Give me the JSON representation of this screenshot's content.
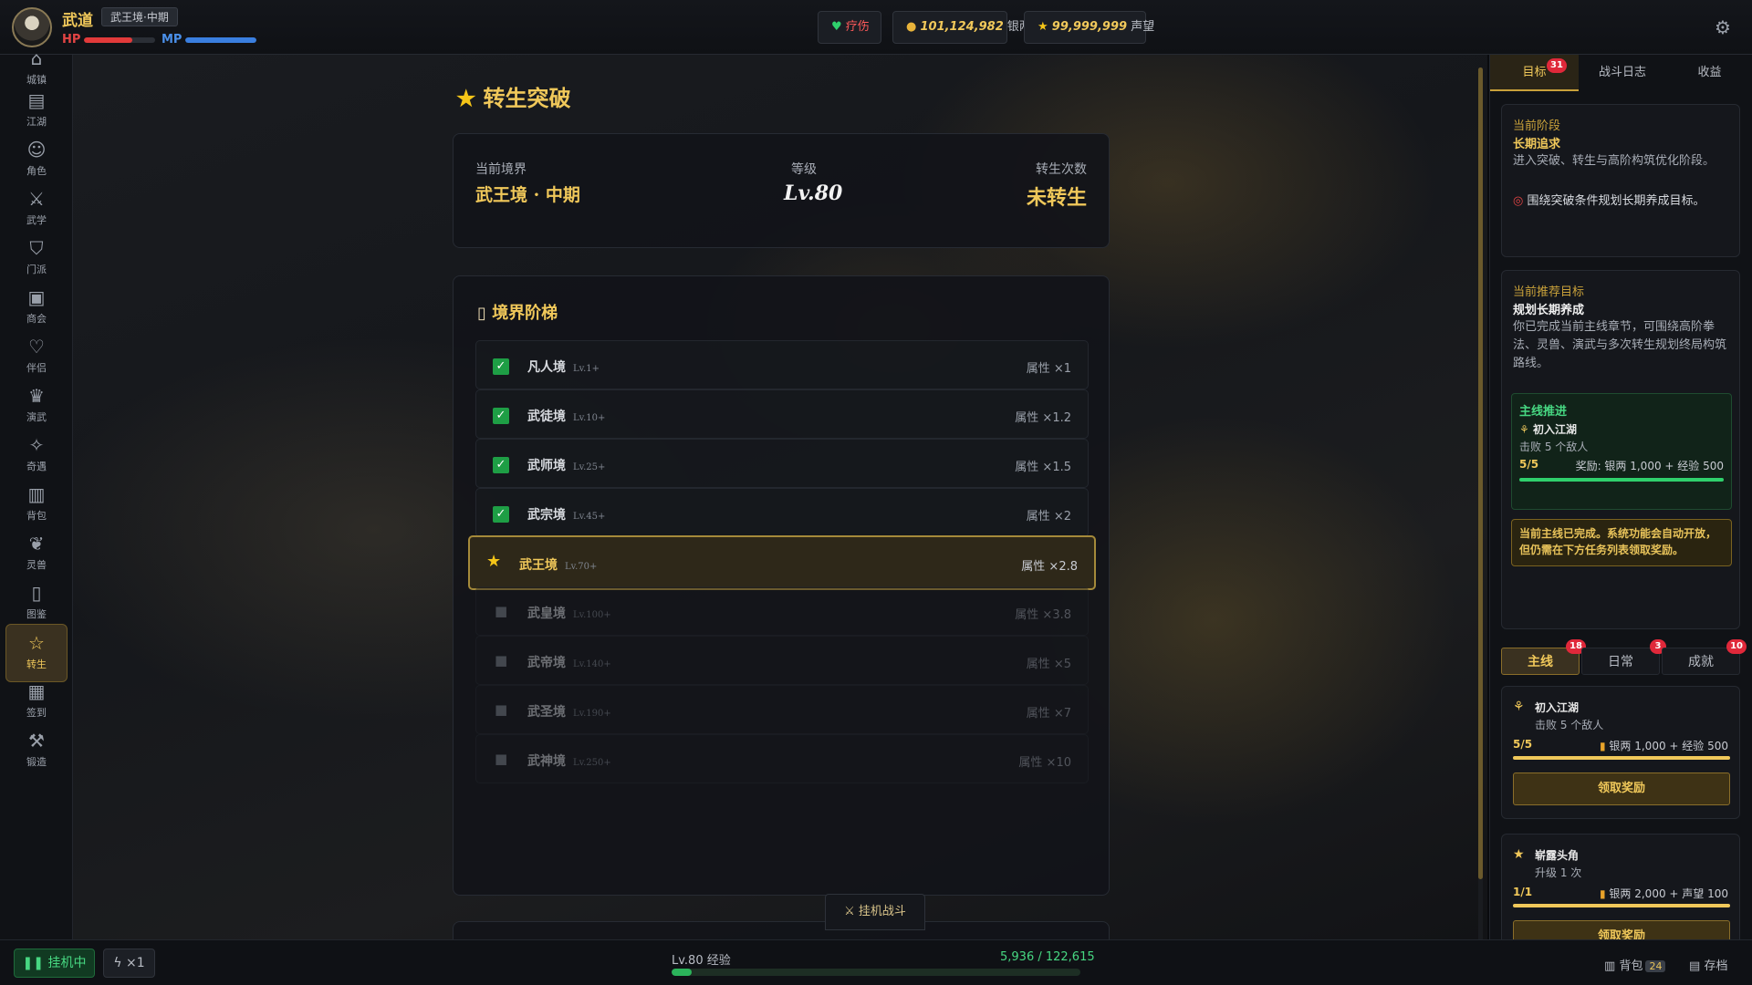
{
  "topbar": {
    "player_name": "武道",
    "realm_badge": "武王境·中期",
    "hp_label": "HP",
    "mp_label": "MP",
    "hp_percent": 68,
    "mp_percent": 100,
    "status_label": "疗伤",
    "silver_value": "101,124,982",
    "silver_unit": "银两",
    "fame_value": "99,999,999",
    "fame_unit": "声望",
    "icons": {
      "status": "heart-icon",
      "silver": "money-bag-icon",
      "fame": "star-icon",
      "settings": "gear-icon"
    }
  },
  "sidebar": {
    "items": [
      {
        "label": "城镇",
        "icon": "town-icon"
      },
      {
        "label": "江湖",
        "icon": "map-icon"
      },
      {
        "label": "角色",
        "icon": "person-icon"
      },
      {
        "label": "武学",
        "icon": "crossed-swords-icon"
      },
      {
        "label": "门派",
        "icon": "shield-icon"
      },
      {
        "label": "商会",
        "icon": "shop-icon"
      },
      {
        "label": "伴侣",
        "icon": "heart-icon"
      },
      {
        "label": "演武",
        "icon": "trophy-icon"
      },
      {
        "label": "奇遇",
        "icon": "sparkle-icon"
      },
      {
        "label": "背包",
        "icon": "backpack-icon"
      },
      {
        "label": "灵兽",
        "icon": "paw-icon"
      },
      {
        "label": "图鉴",
        "icon": "book-icon"
      },
      {
        "label": "转生",
        "icon": "star-outline-icon",
        "active": true
      },
      {
        "label": "签到",
        "icon": "calendar-icon"
      },
      {
        "label": "锻造",
        "icon": "wrench-icon"
      }
    ]
  },
  "main": {
    "title": "转生突破",
    "status": {
      "realm_label": "当前境界",
      "realm_value": "武王境 · 中期",
      "level_label": "等级",
      "level_value": "Lv.80",
      "rebirth_label": "转生次数",
      "rebirth_value": "未转生"
    },
    "ladder": {
      "title": "境界阶梯",
      "rows": [
        {
          "name": "凡人境",
          "level": "Lv.1+",
          "mult": "属性 ×1",
          "state": "done"
        },
        {
          "name": "武徒境",
          "level": "Lv.10+",
          "mult": "属性 ×1.2",
          "state": "done"
        },
        {
          "name": "武师境",
          "level": "Lv.25+",
          "mult": "属性 ×1.5",
          "state": "done"
        },
        {
          "name": "武宗境",
          "level": "Lv.45+",
          "mult": "属性 ×2",
          "state": "done"
        },
        {
          "name": "武王境",
          "level": "Lv.70+",
          "mult": "属性 ×2.8",
          "state": "current"
        },
        {
          "name": "武皇境",
          "level": "Lv.100+",
          "mult": "属性 ×3.8",
          "state": "locked"
        },
        {
          "name": "武帝境",
          "level": "Lv.140+",
          "mult": "属性 ×5",
          "state": "locked"
        },
        {
          "name": "武圣境",
          "level": "Lv.190+",
          "mult": "属性 ×7",
          "state": "locked"
        },
        {
          "name": "武神境",
          "level": "Lv.250+",
          "mult": "属性 ×10",
          "state": "locked"
        }
      ]
    },
    "fight_button": "挂机战斗"
  },
  "right_panel": {
    "tabs": [
      {
        "label": "目标",
        "badge": "31"
      },
      {
        "label": "战斗日志"
      },
      {
        "label": "收益"
      }
    ],
    "stage": {
      "label": "当前阶段",
      "title": "长期追求",
      "desc": "进入突破、转生与高阶构筑优化阶段。",
      "tip": "围绕突破条件规划长期养成目标。"
    },
    "recommend": {
      "label": "当前推荐目标",
      "title": "规划长期养成",
      "desc": "你已完成当前主线章节，可围绕高阶拳法、灵兽、演武与多次转生规划终局构筑路线。",
      "mainline": {
        "label": "主线推进",
        "quest_name": "初入江湖",
        "quest_desc": "击败 5 个敌人",
        "progress": "5/5",
        "progress_percent": 100,
        "reward": "奖励: 银两 1,000 + 经验 500"
      },
      "notice": "当前主线已完成。系统功能会自动开放，但仍需在下方任务列表领取奖励。"
    },
    "quest_tabs": [
      {
        "label": "主线",
        "badge": "18"
      },
      {
        "label": "日常",
        "badge": "3"
      },
      {
        "label": "成就",
        "badge": "10"
      }
    ],
    "quests": [
      {
        "name": "初入江湖",
        "desc": "击败 5 个敌人",
        "progress": "5/5",
        "progress_percent": 100,
        "reward": "银两 1,000 + 经验 500",
        "button": "领取奖励",
        "icon": "sprout-icon"
      },
      {
        "name": "崭露头角",
        "desc": "升级 1 次",
        "progress": "1/1",
        "progress_percent": 100,
        "reward": "银两 2,000 + 声望 100",
        "button": "领取奖励",
        "icon": "star-icon"
      }
    ]
  },
  "bottombar": {
    "idle_label": "挂机中",
    "speed_label": "×1",
    "xp_label": "Lv.80 经验",
    "xp_value": "5,936 / 122,615",
    "xp_percent": 4.8,
    "bag_label": "背包",
    "bag_count": "24",
    "save_label": "存档"
  },
  "colors": {
    "accent": "#f0c85a",
    "green": "#2bb35a",
    "hp": "#e23a3a",
    "mp": "#3a7fe0"
  }
}
